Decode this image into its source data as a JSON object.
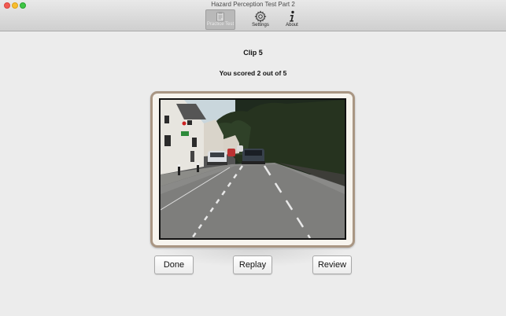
{
  "window": {
    "title": "Hazard Perception Test Part 2"
  },
  "toolbar": {
    "items": [
      {
        "label": "Practice Test",
        "icon": "clipboard-icon",
        "selected": true
      },
      {
        "label": "Settings",
        "icon": "gear-icon",
        "selected": false
      },
      {
        "label": "About",
        "icon": "info-icon",
        "selected": false
      }
    ]
  },
  "main": {
    "clip_title": "Clip 5",
    "score_text": "You scored 2 out of 5"
  },
  "video": {
    "description_icon": "road-video-still"
  },
  "buttons": {
    "done_label": "Done",
    "replay_label": "Replay",
    "review_label": "Review"
  },
  "colors": {
    "frame_border": "#a99683",
    "background": "#ececec"
  }
}
